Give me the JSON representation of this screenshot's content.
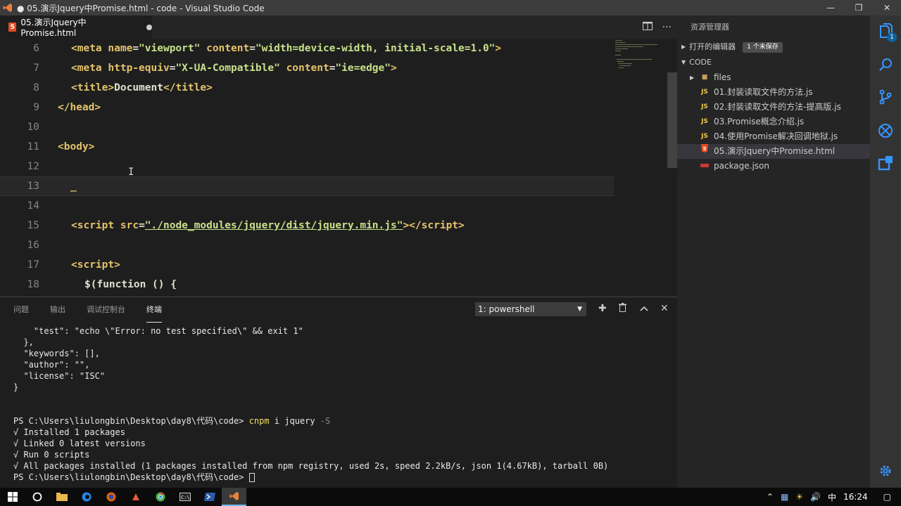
{
  "window": {
    "title": "● 05.演示Jquery中Promise.html - code - Visual Studio Code"
  },
  "tab": {
    "label": "05.演示Jquery中Promise.html"
  },
  "code_lines": [
    {
      "n": "6"
    },
    {
      "n": "7"
    },
    {
      "n": "8"
    },
    {
      "n": "9"
    },
    {
      "n": "10"
    },
    {
      "n": "11"
    },
    {
      "n": "12"
    },
    {
      "n": "13"
    },
    {
      "n": "14"
    },
    {
      "n": "15"
    },
    {
      "n": "16"
    },
    {
      "n": "17"
    },
    {
      "n": "18"
    }
  ],
  "code": {
    "l6_meta": "meta",
    "l6_name": "name",
    "l6_name_val": "\"viewport\"",
    "l6_content": "content",
    "l6_content_val": "\"width=device-width, initial-scale=1.0\"",
    "l7_meta": "meta",
    "l7_http": "http-equiv",
    "l7_http_val": "\"X-UA-Compatible\"",
    "l7_content": "content",
    "l7_content_val": "\"ie=edge\"",
    "l8_title": "title",
    "l8_text": "Document",
    "l8_title_close": "title",
    "l9_head": "head",
    "l11_body": "body",
    "l13_cursor": "_",
    "l15_script": "script",
    "l15_src": "src",
    "l15_src_val": "\"./node_modules/jquery/dist/jquery.min.js\"",
    "l15_script_close": "script",
    "l17_script": "script",
    "l18_text": "$(function () {"
  },
  "panel": {
    "tabs": [
      "问题",
      "输出",
      "调试控制台",
      "终端"
    ],
    "terminal_select": "1: powershell"
  },
  "terminal_lines": [
    "    \"test\": \"echo \\\"Error: no test specified\\\" && exit 1\"",
    "  },",
    "  \"keywords\": [],",
    "  \"author\": \"\",",
    "  \"license\": \"ISC\"",
    "}",
    "",
    ""
  ],
  "terminal_cmd": {
    "prompt": "PS C:\\Users\\liulongbin\\Desktop\\day8\\代码\\code> ",
    "cmd": "cnpm",
    "args": " i jquery ",
    "flag": "-S"
  },
  "terminal_out": [
    "√ Installed 1 packages",
    "√ Linked 0 latest versions",
    "√ Run 0 scripts",
    "√ All packages installed (1 packages installed from npm registry, used 2s, speed 2.2kB/s, json 1(4.67kB), tarball 0B)"
  ],
  "terminal_last_prompt": "PS C:\\Users\\liulongbin\\Desktop\\day8\\代码\\code> ",
  "sidebar": {
    "title": "资源管理器",
    "open_editors": "打开的编辑器",
    "unsaved_badge": "1 个未保存",
    "code_section": "CODE",
    "items": [
      {
        "label": "files",
        "type": "folder"
      },
      {
        "label": "01.封装读取文件的方法.js",
        "type": "js"
      },
      {
        "label": "02.封装读取文件的方法-提高版.js",
        "type": "js"
      },
      {
        "label": "03.Promise概念介绍.js",
        "type": "js"
      },
      {
        "label": "04.使用Promise解决回调地狱.js",
        "type": "js"
      },
      {
        "label": "05.演示Jquery中Promise.html",
        "type": "html"
      },
      {
        "label": "package.json",
        "type": "json"
      }
    ],
    "js_icon_label": "JS"
  },
  "activity": {
    "badge": "1"
  },
  "taskbar": {
    "time": "16:24",
    "ime": "中"
  }
}
